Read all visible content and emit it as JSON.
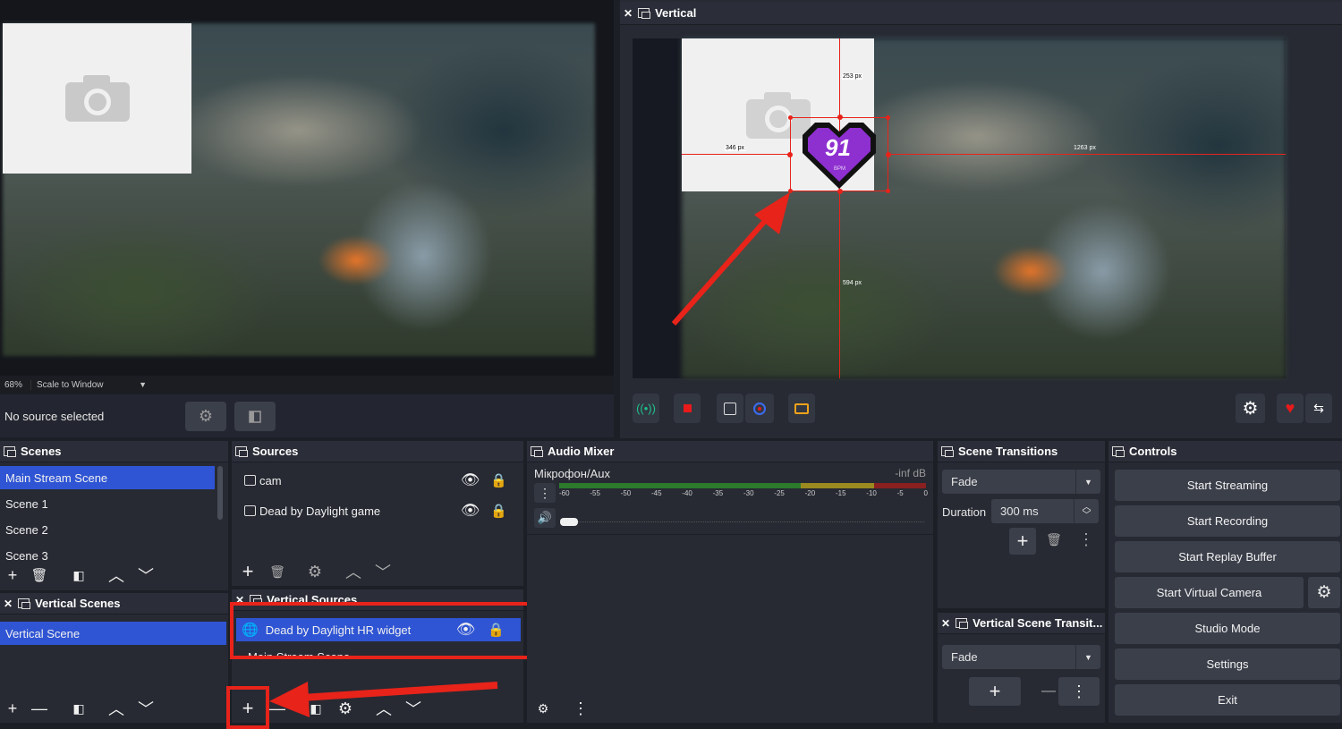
{
  "preview": {
    "zoom": "68%",
    "scale_mode": "Scale to Window",
    "no_source": "No source selected"
  },
  "vertical": {
    "title": "Vertical",
    "widget_value": "91",
    "widget_unit": "BPM",
    "measures": [
      "253 px",
      "346 px",
      "1263 px",
      "594 px"
    ]
  },
  "scenes": {
    "title": "Scenes",
    "items": [
      "Main Stream Scene",
      "Scene 1",
      "Scene 2",
      "Scene 3"
    ]
  },
  "vertical_scenes": {
    "title": "Vertical Scenes",
    "items": [
      "Vertical Scene"
    ]
  },
  "sources": {
    "title": "Sources",
    "items": [
      "cam",
      "Dead by Daylight game"
    ]
  },
  "vertical_sources": {
    "title": "Vertical Sources",
    "items": [
      "Dead by Daylight HR widget",
      "Main Stream Scene"
    ]
  },
  "audio_mixer": {
    "title": "Audio Mixer",
    "channel": "Мікрофон/Aux",
    "level": "-inf dB",
    "ticks": [
      "-60",
      "-55",
      "-50",
      "-45",
      "-40",
      "-35",
      "-30",
      "-25",
      "-20",
      "-15",
      "-10",
      "-5",
      "0"
    ]
  },
  "scene_transitions": {
    "title": "Scene Transitions",
    "transition": "Fade",
    "duration_label": "Duration",
    "duration": "300 ms"
  },
  "vertical_transitions": {
    "title": "Vertical Scene Transit...",
    "transition": "Fade"
  },
  "controls": {
    "title": "Controls",
    "buttons": [
      "Start Streaming",
      "Start Recording",
      "Start Replay Buffer",
      "Start Virtual Camera",
      "Studio Mode",
      "Settings",
      "Exit"
    ]
  },
  "colors": {
    "selection": "#2f55d4",
    "annotation": "#e8231a",
    "widget": "#8e2fd0"
  }
}
